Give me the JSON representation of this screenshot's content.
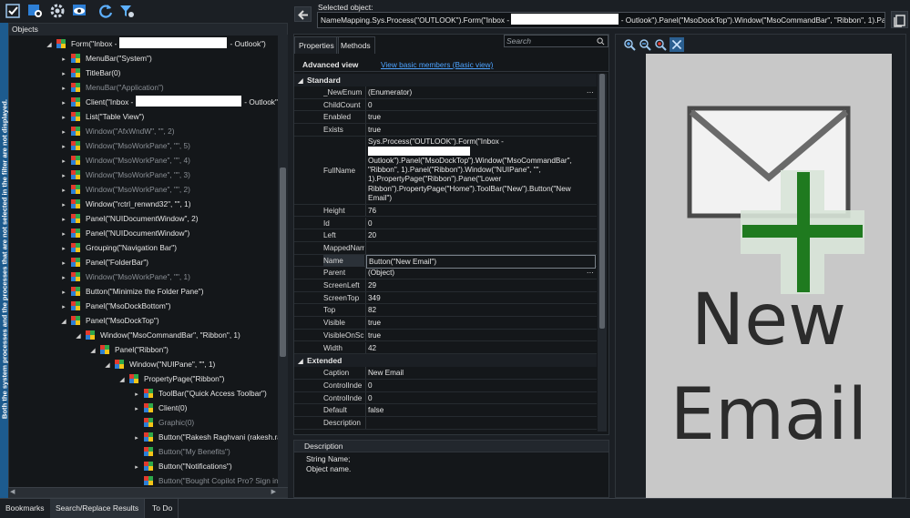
{
  "toolbar": {
    "icons": [
      "highlight-object-icon",
      "object-browser-icon",
      "settings-gear-icon",
      "view-visualizer-icon",
      "refresh-icon",
      "filter-settings-icon"
    ]
  },
  "selected_object": {
    "label": "Selected object:",
    "path_start": "NameMapping.Sys.Process(\"OUTLOOK\").Form(\"Inbox -",
    "path_end": "- Outlook\").Panel(\"MsoDockTop\").Window(\"MsoCommandBar\", \"Ribbon\", 1).Panel"
  },
  "side_strip_text": "Both the system processes and the processes that are not selected in the filter are not displayed.",
  "objects_panel": {
    "title": "Objects",
    "rows": [
      {
        "text": "Form(\"Inbox -",
        "suffix": "- Outlook\")",
        "redact": true,
        "dim": false,
        "arrow": "◢",
        "indent": 0
      },
      {
        "text": "MenuBar(\"System\")",
        "dim": false,
        "arrow": "▸",
        "indent": 1
      },
      {
        "text": "TitleBar(0)",
        "dim": false,
        "arrow": "▸",
        "indent": 1
      },
      {
        "text": "MenuBar(\"Application\")",
        "dim": true,
        "arrow": "▸",
        "indent": 1
      },
      {
        "text": "Client(\"Inbox -",
        "suffix": "- Outlook\")",
        "redact": true,
        "dim": false,
        "arrow": "▸",
        "indent": 1
      },
      {
        "text": "List(\"Table View\")",
        "dim": false,
        "arrow": "▸",
        "indent": 1
      },
      {
        "text": "Window(\"AfxWndW\", \"\", 2)",
        "dim": true,
        "arrow": "▸",
        "indent": 1
      },
      {
        "text": "Window(\"MsoWorkPane\", \"\", 5)",
        "dim": true,
        "arrow": "▸",
        "indent": 1
      },
      {
        "text": "Window(\"MsoWorkPane\", \"\", 4)",
        "dim": true,
        "arrow": "▸",
        "indent": 1
      },
      {
        "text": "Window(\"MsoWorkPane\", \"\", 3)",
        "dim": true,
        "arrow": "▸",
        "indent": 1
      },
      {
        "text": "Window(\"MsoWorkPane\", \"\", 2)",
        "dim": true,
        "arrow": "▸",
        "indent": 1
      },
      {
        "text": "Window(\"rctrl_renwnd32\", \"\", 1)",
        "dim": false,
        "arrow": "▸",
        "indent": 1
      },
      {
        "text": "Panel(\"NUIDocumentWindow\", 2)",
        "dim": false,
        "arrow": "▸",
        "indent": 1
      },
      {
        "text": "Panel(\"NUIDocumentWindow\")",
        "dim": false,
        "arrow": "▸",
        "indent": 1
      },
      {
        "text": "Grouping(\"Navigation Bar\")",
        "dim": false,
        "arrow": "▸",
        "indent": 1
      },
      {
        "text": "Panel(\"FolderBar\")",
        "dim": false,
        "arrow": "▸",
        "indent": 1
      },
      {
        "text": "Window(\"MsoWorkPane\", \"\", 1)",
        "dim": true,
        "arrow": "▸",
        "indent": 1
      },
      {
        "text": "Button(\"Minimize the Folder Pane\")",
        "dim": false,
        "arrow": "▸",
        "indent": 1
      },
      {
        "text": "Panel(\"MsoDockBottom\")",
        "dim": false,
        "arrow": "▸",
        "indent": 1
      },
      {
        "text": "Panel(\"MsoDockTop\")",
        "dim": false,
        "arrow": "◢",
        "indent": 1
      },
      {
        "text": "Window(\"MsoCommandBar\", \"Ribbon\", 1)",
        "dim": false,
        "arrow": "◢",
        "indent": 2
      },
      {
        "text": "Panel(\"Ribbon\")",
        "dim": false,
        "arrow": "◢",
        "indent": 3
      },
      {
        "text": "Window(\"NUIPane\", \"\", 1)",
        "dim": false,
        "arrow": "◢",
        "indent": 4
      },
      {
        "text": "PropertyPage(\"Ribbon\")",
        "dim": false,
        "arrow": "◢",
        "indent": 5
      },
      {
        "text": "ToolBar(\"Quick Access Toolbar\")",
        "dim": false,
        "arrow": "▸",
        "indent": 6
      },
      {
        "text": "Client(0)",
        "dim": false,
        "arrow": "▸",
        "indent": 6
      },
      {
        "text": "Graphic(0)",
        "dim": true,
        "arrow": "",
        "indent": 6
      },
      {
        "text": "Button(\"Rakesh Raghvani (rakesh.ra",
        "dim": false,
        "arrow": "▸",
        "indent": 6
      },
      {
        "text": "Button(\"My Benefits\")",
        "dim": true,
        "arrow": "",
        "indent": 6
      },
      {
        "text": "Button(\"Notifications\")",
        "dim": false,
        "arrow": "▸",
        "indent": 6
      },
      {
        "text": "Button(\"Bought Copilot Pro? Sign in t",
        "dim": true,
        "arrow": "",
        "indent": 6
      }
    ]
  },
  "properties": {
    "tabs": [
      "Properties",
      "Methods"
    ],
    "search_placeholder": "Search",
    "advanced_view": "Advanced view",
    "basic_link": "View basic members (Basic view)",
    "categories": {
      "standard": "Standard",
      "extended": "Extended"
    },
    "standard_rows": [
      {
        "name": "_NewEnum",
        "value": "(Enumerator)",
        "more": true
      },
      {
        "name": "ChildCount",
        "value": "0"
      },
      {
        "name": "Enabled",
        "value": "true"
      },
      {
        "name": "Exists",
        "value": "true"
      },
      {
        "name": "FullName",
        "value_lines": [
          "Sys.Process(\"OUTLOOK\").Form(\"Inbox -",
          "",
          "Outlook\").Panel(\"MsoDockTop\").Window(\"MsoCommandBar\",",
          "\"Ribbon\", 1).Panel(\"Ribbon\").Window(\"NUIPane\", \"\",",
          "1).PropertyPage(\"Ribbon\").Pane(\"Lower",
          "Ribbon\").PropertyPage(\"Home\").ToolBar(\"New\").Button(\"New",
          "Email\")"
        ]
      },
      {
        "name": "Height",
        "value": "76"
      },
      {
        "name": "Id",
        "value": "0"
      },
      {
        "name": "Left",
        "value": "20"
      },
      {
        "name": "MappedNam",
        "value": ""
      },
      {
        "name": "Name",
        "value": "Button(\"New Email\")",
        "selected": true
      },
      {
        "name": "Parent",
        "value": "(Object)",
        "more": true
      },
      {
        "name": "ScreenLeft",
        "value": "29"
      },
      {
        "name": "ScreenTop",
        "value": "349"
      },
      {
        "name": "Top",
        "value": "82"
      },
      {
        "name": "Visible",
        "value": "true"
      },
      {
        "name": "VisibleOnScr",
        "value": "true"
      },
      {
        "name": "Width",
        "value": "42"
      }
    ],
    "extended_rows": [
      {
        "name": "Caption",
        "value": "New Email"
      },
      {
        "name": "ControlInde",
        "value": "0"
      },
      {
        "name": "ControlInde",
        "value": "0"
      },
      {
        "name": "Default",
        "value": "false"
      },
      {
        "name": "Description",
        "value": ""
      }
    ]
  },
  "description": {
    "title": "Description",
    "line1": "String Name;",
    "line2": "Object name."
  },
  "preview": {
    "caption_line1": "New",
    "caption_line2": "Email",
    "tool_icons": [
      "zoom-in-icon",
      "zoom-out-icon",
      "zoom-reset-icon",
      "fit-to-window-icon"
    ]
  },
  "bottom_tabs": [
    "Bookmarks",
    "Search/Replace Results",
    "To Do"
  ],
  "colors": {
    "accent": "#1d5b8e",
    "background": "#1b1f24",
    "selection": "#2b3138"
  }
}
